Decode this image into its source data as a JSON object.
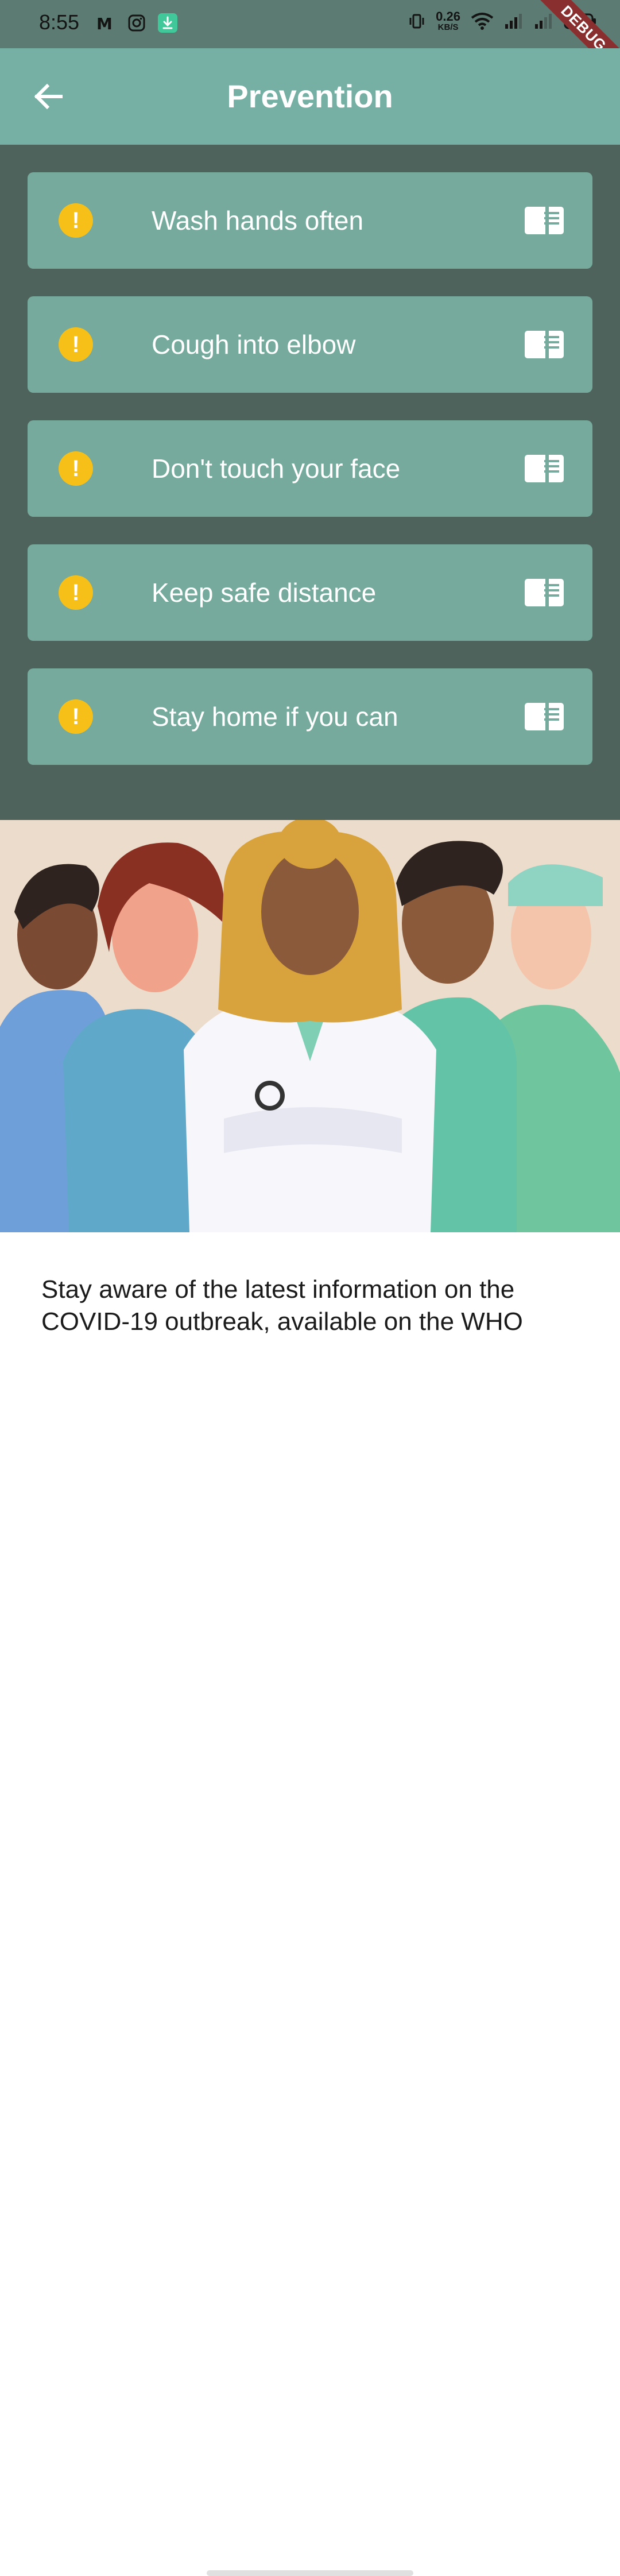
{
  "status_bar": {
    "time": "8:55",
    "net_speed_value": "0.26",
    "net_speed_unit": "KB/S",
    "debug_label": "DEBUG",
    "icons": [
      "app-icon",
      "instagram-icon",
      "download-icon",
      "vibrate-icon",
      "wifi-icon",
      "signal-icon",
      "signal-icon",
      "battery-icon"
    ]
  },
  "app_bar": {
    "title": "Prevention",
    "back_icon": "arrow-back-icon"
  },
  "prevention_items": [
    {
      "label": "Wash hands often",
      "icon": "warning-icon",
      "action_icon": "article-icon"
    },
    {
      "label": "Cough into elbow",
      "icon": "warning-icon",
      "action_icon": "article-icon"
    },
    {
      "label": "Don't touch your face",
      "icon": "warning-icon",
      "action_icon": "article-icon"
    },
    {
      "label": "Keep safe distance",
      "icon": "warning-icon",
      "action_icon": "article-icon"
    },
    {
      "label": "Stay home if you can",
      "icon": "warning-icon",
      "action_icon": "article-icon"
    }
  ],
  "footer": {
    "text": "Stay aware of the latest information on the COVID-19 outbreak, available on the WHO"
  },
  "colors": {
    "status_bar": "#5c7b72",
    "app_bar": "#76b0a4",
    "list_background": "#4e635c",
    "card": "#75aa9d",
    "warning": "#f7c019",
    "illustration_bg": "#ecdccb"
  }
}
